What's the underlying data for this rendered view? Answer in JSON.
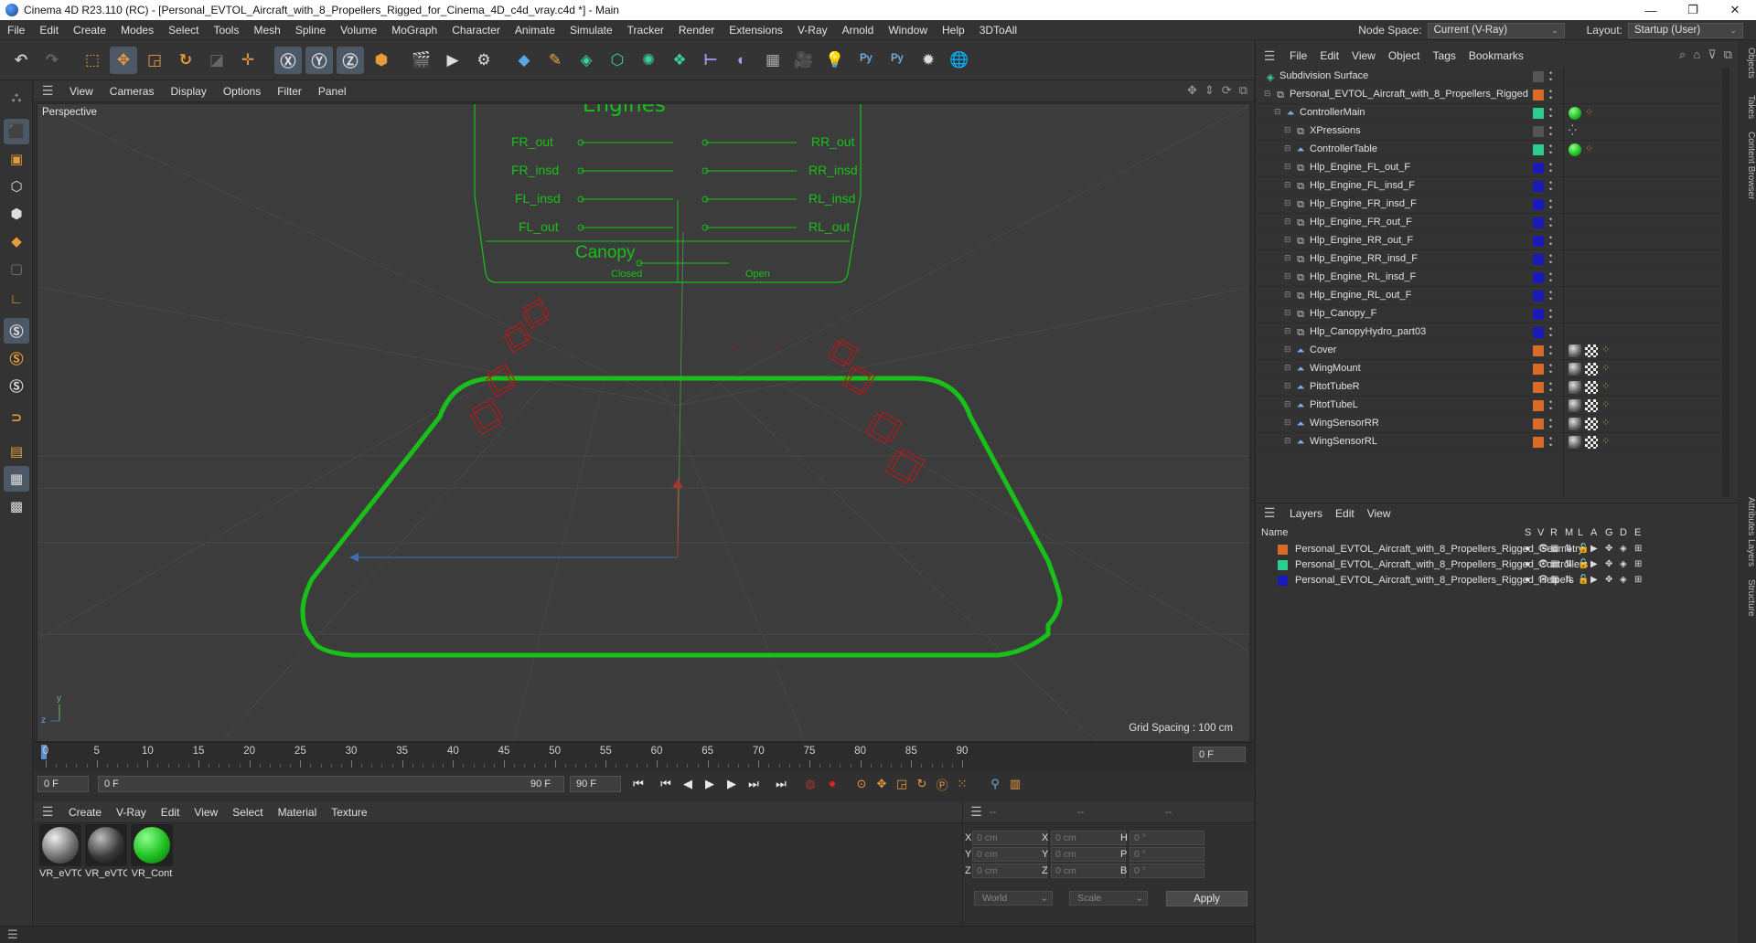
{
  "window": {
    "title": "Cinema 4D R23.110 (RC) - [Personal_EVTOL_Aircraft_with_8_Propellers_Rigged_for_Cinema_4D_c4d_vray.c4d *] - Main",
    "minimize": "—",
    "maximize": "❐",
    "close": "✕"
  },
  "menubar": {
    "items": [
      "File",
      "Edit",
      "Create",
      "Modes",
      "Select",
      "Tools",
      "Mesh",
      "Spline",
      "Volume",
      "MoGraph",
      "Character",
      "Animate",
      "Simulate",
      "Tracker",
      "Render",
      "Extensions",
      "V-Ray",
      "Arnold",
      "Window",
      "Help",
      "3DToAll"
    ],
    "node_space_label": "Node Space:",
    "node_space_value": "Current (V-Ray)",
    "layout_label": "Layout:",
    "layout_value": "Startup (User)"
  },
  "viewport": {
    "menu": [
      "View",
      "Cameras",
      "Display",
      "Options",
      "Filter",
      "Panel"
    ],
    "label": "Perspective",
    "grid_spacing": "Grid Spacing : 100 cm",
    "axis_y": "y",
    "axis_z": "z",
    "panel_title": "Engines",
    "panel_labels_left": [
      "FR_out",
      "FR_insd",
      "FL_insd",
      "FL_out"
    ],
    "panel_labels_right": [
      "RR_out",
      "RR_insd",
      "RL_insd",
      "RL_out"
    ],
    "canopy_label": "Canopy",
    "canopy_closed": "Closed",
    "canopy_open": "Open"
  },
  "timeline": {
    "ticks": [
      "0",
      "5",
      "10",
      "15",
      "20",
      "25",
      "30",
      "35",
      "40",
      "45",
      "50",
      "55",
      "60",
      "65",
      "70",
      "75",
      "80",
      "85",
      "90"
    ],
    "current_frame": "0 F"
  },
  "transport": {
    "start": "0 F",
    "range_start": "0 F",
    "range_end": "90 F",
    "end": "90 F"
  },
  "materials": {
    "menu": [
      "Create",
      "V-Ray",
      "Edit",
      "View",
      "Select",
      "Material",
      "Texture"
    ],
    "items": [
      {
        "name": "VR_eVTO",
        "color": "#8a8a8a"
      },
      {
        "name": "VR_eVTO",
        "color": "#505050"
      },
      {
        "name": "VR_Cont",
        "color": "#1fbf1f"
      }
    ]
  },
  "coordinates": {
    "head_dashes": [
      "--",
      "--",
      "--"
    ],
    "rows": [
      {
        "a": "X",
        "av": "0 cm",
        "b": "X",
        "bv": "0 cm",
        "c": "H",
        "cv": "0 °"
      },
      {
        "a": "Y",
        "av": "0 cm",
        "b": "Y",
        "bv": "0 cm",
        "c": "P",
        "cv": "0 °"
      },
      {
        "a": "Z",
        "av": "0 cm",
        "b": "Z",
        "bv": "0 cm",
        "c": "B",
        "cv": "0 °"
      }
    ],
    "mode1": "World",
    "mode2": "Scale",
    "apply": "Apply"
  },
  "object_manager": {
    "menu": [
      "File",
      "Edit",
      "View",
      "Object",
      "Tags",
      "Bookmarks"
    ],
    "objects": [
      {
        "name": "Subdivision Surface",
        "indent": 0,
        "color": "#555555",
        "icon": "subdiv-icon",
        "tags": []
      },
      {
        "name": "Personal_EVTOL_Aircraft_with_8_Propellers_Rigged",
        "indent": 1,
        "color": "#d86a2a",
        "icon": "null-icon",
        "tags": []
      },
      {
        "name": "ControllerMain",
        "indent": 2,
        "color": "#2ecc8e",
        "icon": "joint-icon",
        "tags": [
          "green",
          "orange"
        ]
      },
      {
        "name": "XPressions",
        "indent": 3,
        "color": "#555555",
        "icon": "null-icon",
        "tags": [
          "xpresso"
        ]
      },
      {
        "name": "ControllerTable",
        "indent": 3,
        "color": "#2ecc8e",
        "icon": "joint-icon",
        "tags": [
          "green",
          "orange"
        ]
      },
      {
        "name": "Hlp_Engine_FL_out_F",
        "indent": 3,
        "color": "#1a1ab8",
        "icon": "null-icon",
        "tags": []
      },
      {
        "name": "Hlp_Engine_FL_insd_F",
        "indent": 3,
        "color": "#1a1ab8",
        "icon": "null-icon",
        "tags": []
      },
      {
        "name": "Hlp_Engine_FR_insd_F",
        "indent": 3,
        "color": "#1a1ab8",
        "icon": "null-icon",
        "tags": []
      },
      {
        "name": "Hlp_Engine_FR_out_F",
        "indent": 3,
        "color": "#1a1ab8",
        "icon": "null-icon",
        "tags": []
      },
      {
        "name": "Hlp_Engine_RR_out_F",
        "indent": 3,
        "color": "#1a1ab8",
        "icon": "null-icon",
        "tags": []
      },
      {
        "name": "Hlp_Engine_RR_insd_F",
        "indent": 3,
        "color": "#1a1ab8",
        "icon": "null-icon",
        "tags": []
      },
      {
        "name": "Hlp_Engine_RL_insd_F",
        "indent": 3,
        "color": "#1a1ab8",
        "icon": "null-icon",
        "tags": []
      },
      {
        "name": "Hlp_Engine_RL_out_F",
        "indent": 3,
        "color": "#1a1ab8",
        "icon": "null-icon",
        "tags": []
      },
      {
        "name": "Hlp_Canopy_F",
        "indent": 3,
        "color": "#1a1ab8",
        "icon": "null-icon",
        "tags": []
      },
      {
        "name": "Hlp_CanopyHydro_part03",
        "indent": 3,
        "color": "#1a1ab8",
        "icon": "null-icon",
        "tags": []
      },
      {
        "name": "Cover",
        "indent": 3,
        "color": "#d86a2a",
        "icon": "joint-icon",
        "tags": [
          "mat",
          "check",
          "orange"
        ]
      },
      {
        "name": "WingMount",
        "indent": 3,
        "color": "#d86a2a",
        "icon": "joint-icon",
        "tags": [
          "mat",
          "check",
          "orange"
        ]
      },
      {
        "name": "PitotTubeR",
        "indent": 3,
        "color": "#d86a2a",
        "icon": "joint-icon",
        "tags": [
          "mat",
          "check",
          "orange"
        ]
      },
      {
        "name": "PitotTubeL",
        "indent": 3,
        "color": "#d86a2a",
        "icon": "joint-icon",
        "tags": [
          "mat",
          "check",
          "orange"
        ]
      },
      {
        "name": "WingSensorRR",
        "indent": 3,
        "color": "#d86a2a",
        "icon": "joint-icon",
        "tags": [
          "mat",
          "check",
          "orange"
        ]
      },
      {
        "name": "WingSensorRL",
        "indent": 3,
        "color": "#d86a2a",
        "icon": "joint-icon",
        "tags": [
          "mat",
          "check",
          "orange"
        ]
      }
    ]
  },
  "layers": {
    "menu": [
      "Layers",
      "Edit",
      "View"
    ],
    "columns": {
      "name": "Name",
      "flags": [
        "S",
        "V",
        "R",
        "M",
        "L",
        "A",
        "G",
        "D",
        "E"
      ]
    },
    "items": [
      {
        "name": "Personal_EVTOL_Aircraft_with_8_Propellers_Rigged_Geometry",
        "color": "#d86a2a"
      },
      {
        "name": "Personal_EVTOL_Aircraft_with_8_Propellers_Rigged_Controllers",
        "color": "#2ecc8e"
      },
      {
        "name": "Personal_EVTOL_Aircraft_with_8_Propellers_Rigged_Helpers",
        "color": "#1a1ab8"
      }
    ]
  },
  "side_tabs": [
    "Objects",
    "Takes",
    "Content Browser",
    "Attributes",
    "Layers",
    "Structure"
  ]
}
